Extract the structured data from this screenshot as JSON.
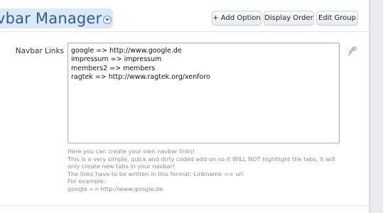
{
  "header": {
    "title": "vbar Manager",
    "buttons": {
      "add_option": "+ Add Option",
      "display_order": "Display Order",
      "edit_group": "Edit Group"
    }
  },
  "option": {
    "label": "Navbar Links",
    "value": "google => http://www.google.de\nimpressum => impressum\nmembers2 => members\nragtek => http://www.ragtek.org/xenforo",
    "help_lines": [
      "Here you can create your own navbar links!",
      "This is a very simple, quick and dirty coded add-on so it WILL NOT hightlight the tabs, it will",
      "only create new tabs in your navbar!",
      "The links have to be written in this format: Linkname => url",
      "For example:",
      "google => http://www.google.de"
    ]
  },
  "icons": {
    "title_chevron": "chevron-down-icon",
    "edit": "pencil-wrench-icon"
  },
  "colors": {
    "title_text": "#2f5f93",
    "title_bg": "#dbe8f6",
    "help_text": "#888e96"
  }
}
